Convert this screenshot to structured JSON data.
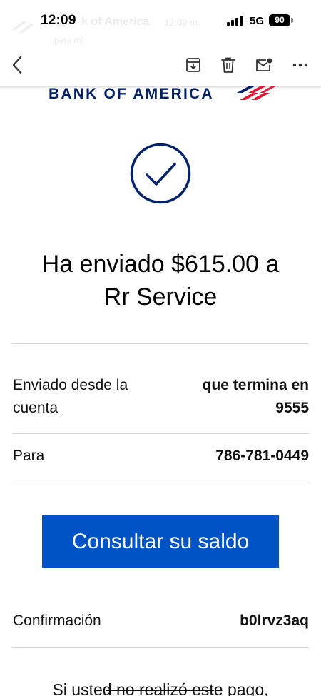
{
  "status_bar": {
    "time": "12:09",
    "network": "5G",
    "battery": "90"
  },
  "background_notification": {
    "sender": "k of America",
    "time": "12:09 m.",
    "subtitle": "para mí"
  },
  "toolbar": {
    "back": "back-icon",
    "archive": "archive-icon",
    "trash": "trash-icon",
    "mark_unread": "mark-unread-icon",
    "more": "more-icon"
  },
  "email": {
    "brand": "BANK OF AMERICA",
    "headline_line1": "Ha enviado $615.00 a",
    "headline_line2": "Rr Service",
    "from_label_line1": "Enviado desde la",
    "from_label_line2": "cuenta",
    "from_value_line1": "que termina en",
    "from_value_line2": "9555",
    "to_label": "Para",
    "to_value": "786-781-0449",
    "cta_label": "Consultar su saldo",
    "confirmation_label": "Confirmación",
    "confirmation_value": "b0lrvz3aq",
    "footer_text": "Si usted no realizó este pago,"
  },
  "colors": {
    "brand_navy": "#012169",
    "brand_red": "#e31837",
    "button_blue": "#0053c4"
  }
}
